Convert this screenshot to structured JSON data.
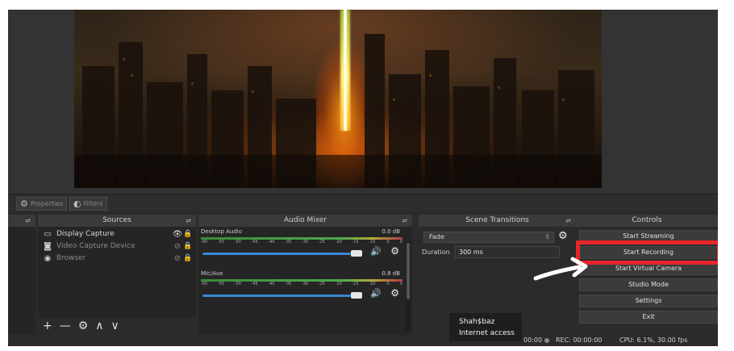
{
  "tabs": {
    "properties": "Properties",
    "filters": "Filters"
  },
  "sources": {
    "title": "Sources",
    "items": [
      {
        "name": "Display Capture",
        "icon": "monitor-icon",
        "visible": true
      },
      {
        "name": "Video Capture Device",
        "icon": "camera-icon",
        "visible": false
      },
      {
        "name": "Browser",
        "icon": "globe-icon",
        "visible": false
      }
    ],
    "toolbar": {
      "add": "+",
      "remove": "—",
      "settings": "⚙",
      "up": "∧",
      "down": "∨"
    }
  },
  "audio_mixer": {
    "title": "Audio Mixer",
    "tracks": [
      {
        "name": "Desktop Audio",
        "db": "0.0 dB",
        "ticks": [
          "-60",
          "-55",
          "-50",
          "-45",
          "-40",
          "-35",
          "-30",
          "-25",
          "-20",
          "-15",
          "-10",
          "-5",
          "0"
        ]
      },
      {
        "name": "Mic/Aux",
        "db": "0.8 dB",
        "ticks": [
          "-60",
          "-55",
          "-50",
          "-45",
          "-40",
          "-35",
          "-30",
          "-25",
          "-20",
          "-15",
          "-10",
          "-5",
          "0"
        ]
      }
    ]
  },
  "scene_transitions": {
    "title": "Scene Transitions",
    "selected": "Fade",
    "duration_label": "Duration",
    "duration_value": "300 ms"
  },
  "controls": {
    "title": "Controls",
    "buttons": [
      "Start Streaming",
      "Start Recording",
      "Start Virtual Camera",
      "Studio Mode",
      "Settings",
      "Exit"
    ]
  },
  "status": {
    "live_time": "00:00",
    "rec": "REC: 00:00:00",
    "cpu": "CPU: 6.1%, 30.00 fps"
  },
  "watermark": {
    "line1": "Shah$baz",
    "line2": "Internet access"
  },
  "colors": {
    "highlight": "#e8252b",
    "fader": "#3a86d6"
  }
}
